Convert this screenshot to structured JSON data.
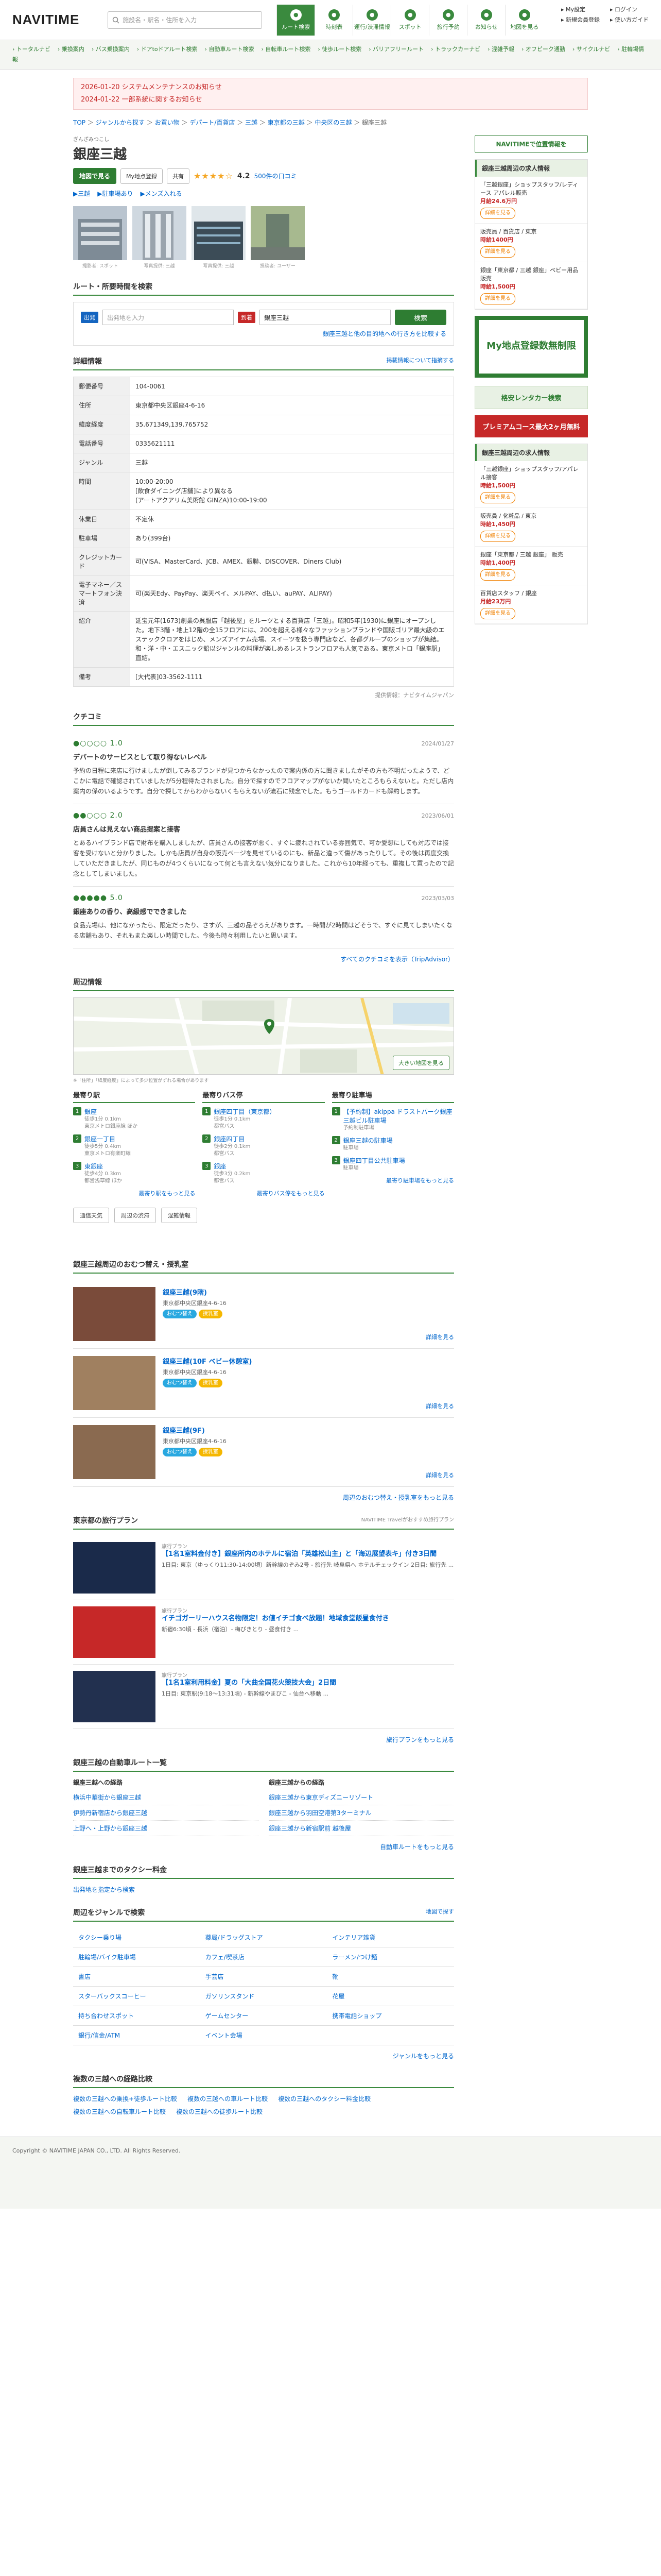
{
  "header": {
    "logo": "NAVITIME",
    "search_placeholder": "施設名・駅名・住所を入力",
    "nav": [
      {
        "label": "ルート検索",
        "icon": "route-icon",
        "active": true
      },
      {
        "label": "時刻表",
        "icon": "timetable-icon",
        "active": false
      },
      {
        "label": "運行/渋滞情報",
        "icon": "traffic-icon",
        "active": false
      },
      {
        "label": "スポット",
        "icon": "spot-icon",
        "active": false
      },
      {
        "label": "旅行予約",
        "icon": "travel-icon",
        "active": false
      },
      {
        "label": "お知らせ",
        "icon": "bell-icon",
        "active": false
      },
      {
        "label": "地図を見る",
        "icon": "map-icon",
        "active": false
      }
    ],
    "links": [
      "My設定",
      "ログイン",
      "新規会員登録",
      "使い方ガイド"
    ]
  },
  "subnav": [
    "トータルナビ",
    "乗換案内",
    "バス乗換案内",
    "ドアtoドアルート検索",
    "自動車ルート検索",
    "自転車ルート検索",
    "徒歩ルート検索",
    "バリアフリールート",
    "トラックカーナビ",
    "混雑予報",
    "オフピーク通勤",
    "サイクルナビ",
    "駐輪場情報"
  ],
  "notices": [
    "2026-01-20 システムメンテナンスのお知らせ",
    "2024-01-22 一部系統に関するお知らせ"
  ],
  "breadcrumb": [
    "TOP",
    "ジャンルから探す",
    "お買い物",
    "デパート/百貨店",
    "三越",
    "東京都の三越",
    "中央区の三越",
    "銀座三越"
  ],
  "spot": {
    "ruby": "ぎんざみつこし",
    "name": "銀座三越",
    "btn_map": "地図で見る",
    "btn_mypoint": "My地点登録",
    "btn_share": "共有",
    "stars": "★★★★☆",
    "rating": "4.2",
    "reviews": "500件の口コミ",
    "sublinks": [
      "▶三越",
      "▶駐車場あり",
      "▶メンズ入れる"
    ],
    "photo_caps": [
      "撮影者: スポット",
      "写真提供: 三越",
      "写真提供: 三越",
      "投稿者: ユーザー"
    ]
  },
  "route": {
    "title": "ルート・所要時間を検索",
    "from_tag": "出発",
    "from_placeholder": "出発地を入力",
    "to_tag": "到着",
    "to_value": "銀座三越",
    "search": "検索",
    "compare": "銀座三越と他の目的地への行き方を比較する"
  },
  "detail": {
    "title": "詳細情報",
    "report": "掲載情報について指摘する",
    "rows": [
      {
        "k": "郵便番号",
        "v": "104-0061"
      },
      {
        "k": "住所",
        "v": "東京都中央区銀座4-6-16"
      },
      {
        "k": "緯度経度",
        "v": "35.671349,139.765752"
      },
      {
        "k": "電話番号",
        "v": "0335621111"
      },
      {
        "k": "ジャンル",
        "v": "三越"
      },
      {
        "k": "時間",
        "v": "10:00-20:00\n[飲食ダイニング店舗]により異なる\n(アートアクアリム美術館 GINZA)10:00-19:00"
      },
      {
        "k": "休業日",
        "v": "不定休"
      },
      {
        "k": "駐車場",
        "v": "あり(399台)"
      },
      {
        "k": "クレジットカード",
        "v": "可(VISA、MasterCard、JCB、AMEX、銀聯、DISCOVER、Diners Club)"
      },
      {
        "k": "電子マネー／スマートフォン決済",
        "v": "可(楽天Edy、PayPay、楽天ペイ、メルPAY、d払い、auPAY、ALIPAY)"
      },
      {
        "k": "紹介",
        "v": "延宝元年(1673)創業の呉服店「越後屋」をルーツとする百貨店「三越」。昭和5年(1930)に銀座にオープンした。地下3階・地上12階の全15フロアには、200を超える様々なファッションブランドや国販ゴリア最大級のエステッククロアをはじめ、メンズアイテム売場、スイーツを扱う専門店など、各都グループのショップが集結。和・洋・中・エスニック鉛以ジャンルの料理が楽しめるレストランフロアも人気である。東京メトロ「銀座駅」直結。"
      },
      {
        "k": "備考",
        "v": "[大代表]03-3562-1111"
      }
    ],
    "provider": "提供情報：ナビタイムジャパン"
  },
  "reviews": {
    "title": "クチコミ",
    "items": [
      {
        "score": "●○○○○ 1.0",
        "date": "2024/01/27",
        "title": "デパートのサービスとして取り得ないレベル",
        "text": "予約の日程に来店に行けましたが倒してみるブランドが見つからなかったので案内係の方に聞きましたがその方も不明だったようで、どこかに電話で確認されていましたが5分程待たされました。自分で探すのでフロアマップがないか聞いたところもらえないと。ただし店内案内の係のいるようです。自分で探してからわからないくもらえないが流石に残念でした。もうゴールドカードも解約します。"
      },
      {
        "score": "●●○○○ 2.0",
        "date": "2023/06/01",
        "title": "店員さんは見えない商品提案と接客",
        "text": "とあるハイブランド店で財布を購入しましたが、店員さんの接客が悪く、すぐに疲れされている雰囲気で、可か愛想にしても対応では接客を受けないと分かりました。しかも店員が自身の販売ページを見せているのにも、新品と違って傷があったりして。その後は再度交換していただきましたが、同じものが4つくらいになって何とも言えない気分になりました。これから10年経っても、重複して買ったので記念としてしまいました。"
      },
      {
        "score": "●●●●● 5.0",
        "date": "2023/03/03",
        "title": "銀座ありの香り、高級感でできました",
        "text": "食品売場は、他になかったら、限定だったり、さすが、三越の品ぞろえがあります。一時間が2時間はどそうで、すぐに見てしまいたくなる店舗もあり、それもまた楽しい時間でした。今後も時々利用したいと思います。"
      }
    ],
    "more": "すべてのクチコミを表示（TripAdvisor）"
  },
  "nearby": {
    "map_title": "周辺情報",
    "map_big": "大きい地図を見る",
    "map_note": "※「住所」「緯度経度」によって多少位置がずれる場合があります",
    "cols": [
      {
        "title": "最寄り駅",
        "items": [
          {
            "n": "1",
            "name": "銀座",
            "sub": "徒歩1分 0.1km\n東京メトロ銀座線 ほか"
          },
          {
            "n": "2",
            "name": "銀座一丁目",
            "sub": "徒歩5分 0.4km\n東京メトロ有楽町線"
          },
          {
            "n": "3",
            "name": "東銀座",
            "sub": "徒歩4分 0.3km\n都営浅草線 ほか"
          }
        ],
        "more": "最寄り駅をもっと見る"
      },
      {
        "title": "最寄りバス停",
        "items": [
          {
            "n": "1",
            "name": "銀座四丁目（東京都）",
            "sub": "徒歩1分 0.1km\n都営バス"
          },
          {
            "n": "2",
            "name": "銀座四丁目",
            "sub": "徒歩2分 0.1km\n都営バス"
          },
          {
            "n": "3",
            "name": "銀座",
            "sub": "徒歩3分 0.2km\n都営バス"
          }
        ],
        "more": "最寄りバス停をもっと見る"
      },
      {
        "title": "最寄り駐車場",
        "items": [
          {
            "n": "1",
            "name": "【予約制】akippa ドラストパーク銀座三越ビル駐車場",
            "sub": "予約制駐車場"
          },
          {
            "n": "2",
            "name": "銀座三越の駐車場",
            "sub": "駐車場"
          },
          {
            "n": "3",
            "name": "銀座四丁目公共駐車場",
            "sub": "駐車場"
          }
        ],
        "more": "最寄り駐車場をもっと見る"
      }
    ],
    "buttons": [
      "通信天気",
      "周辺の渋滞",
      "混雑情報"
    ]
  },
  "gourmet": {
    "title": "銀座三越周辺のおむつ替え・授乳室",
    "items": [
      {
        "name": "銀座三越(9階)",
        "addr": "東京都中央区銀座4-6-16",
        "tags": [
          "おむつ替え",
          "授乳室"
        ]
      },
      {
        "name": "銀座三越(10F ベビー休憩室)",
        "addr": "東京都中央区銀座4-6-16",
        "tags": [
          "おむつ替え",
          "授乳室"
        ]
      },
      {
        "name": "銀座三越(9F)",
        "addr": "東京都中央区銀座4-6-16",
        "tags": [
          "おむつ替え",
          "授乳室"
        ]
      }
    ],
    "detail": "詳細を見る",
    "more": "周辺のおむつ替え・授乳室をもっと見る"
  },
  "tours": {
    "title": "東京都の旅行プラン",
    "credit": "NAVITIME Travelがおすすめ旅行プラン",
    "items": [
      {
        "tag": "旅行プラン",
        "title": "【1名1室料金付き】銀座所内のホテルに宿泊「英雄松山主」と「海辺展望表キ」付き3日間",
        "desc": "1日目: 東京（ゆっくり11:30-14:00頃）新幹線のぞみ2号 - 旅行先 岐阜県へ ホテルチェックイン 2日目: 旅行先 ..."
      },
      {
        "tag": "旅行プラン",
        "title": "イチゴガーリーハウス名物限定！お値イチゴ食べ放題！地域食堂飯昼食付き",
        "desc": "新宿6:30頃 - 長浜（宿泊）- 梅ぴきとり - 昼食付き ..."
      },
      {
        "tag": "旅行プラン",
        "title": "【1名1室利用料金】夏の「大曲全国花火競技大会」2日間",
        "desc": "1日目: 東京駅(9:18〜13:31頃) - 新幹線やまびこ - 仙台へ移動 ..."
      }
    ],
    "more": "旅行プランをもっと見る"
  },
  "routes": {
    "title": "銀座三越の自動車ルート一覧",
    "from_head": "銀座三越への経路",
    "to_head": "銀座三越からの経路",
    "from": [
      "横浜中華街から銀座三越",
      "伊勢丹新宿店から銀座三越",
      "上野へ・上野から銀座三越"
    ],
    "to": [
      "銀座三越から東京ディズニーリゾート",
      "銀座三越から羽田空港第3ターミナル",
      "銀座三越から新宿駅前 越後屋"
    ],
    "more": "自動車ルートをもっと見る"
  },
  "taxi": {
    "title": "銀座三越までのタクシー料金",
    "link": "出発地を指定から検索"
  },
  "genres": {
    "title": "周辺をジャンルで検索",
    "map": "地図で探す",
    "items": [
      "タクシー乗り場",
      "薬局/ドラッグストア",
      "インテリア雑貨",
      "駐輪場/バイク駐車場",
      "カフェ/喫茶店",
      "ラーメン/つけ麺",
      "書店",
      "手芸店",
      "靴",
      "スターバックスコーヒー",
      "ガソリンスタンド",
      "花屋",
      "持ち合わせスポット",
      "ゲームセンター",
      "携帯電話ショップ",
      "銀行/信金/ATM",
      "イベント会場",
      ""
    ],
    "more": "ジャンルをもっと見る"
  },
  "multi": {
    "title": "複数の三越への経路比較",
    "links": [
      "複数の三越への乗換+徒歩ルート比較",
      "複数の三越への車ルート比較",
      "複数の三越へのタクシー料金比較",
      "複数の三越への自転車ルート比較",
      "複数の三越への徒歩ルート比較"
    ]
  },
  "side": {
    "btn": "NAVITIMEで位置情報を",
    "jobs_title": "銀座三越周辺の求人情報",
    "jobs": [
      {
        "t": "「三越銀座」ショップスタッフ/レディース アパレル販売",
        "s": "月給24.6万円",
        "kb": "詳細を見る"
      },
      {
        "t": "販売員 / 百貨店 / 東京",
        "s": "時給1400円",
        "kb": "詳細を見る"
      },
      {
        "t": "銀座「東京都 / 三越 銀座」ベビー用品販売",
        "s": "時給1,500円",
        "kb": "詳細を見る"
      }
    ],
    "ad1": "My地点登録数無制限",
    "ad2": "格安レンタカー検索",
    "ad3": "プレミアムコース最大2ヶ月無料",
    "jobs2": [
      {
        "t": "「三越銀座」ショップスタッフ/アパレル接客",
        "s": "時給1,500円",
        "kb": "詳細を見る"
      },
      {
        "t": "販売員 / 化粧品 / 東京",
        "s": "時給1,450円",
        "kb": "詳細を見る"
      },
      {
        "t": "銀座「東京都 / 三越 銀座」 販売",
        "s": "時給1,400円",
        "kb": "詳細を見る"
      },
      {
        "t": "百貨店スタッフ / 銀座",
        "s": "月給23万円",
        "kb": "詳細を見る"
      }
    ]
  },
  "footer": "Copyright © NAVITIME JAPAN CO., LTD. All Rights Reserved."
}
